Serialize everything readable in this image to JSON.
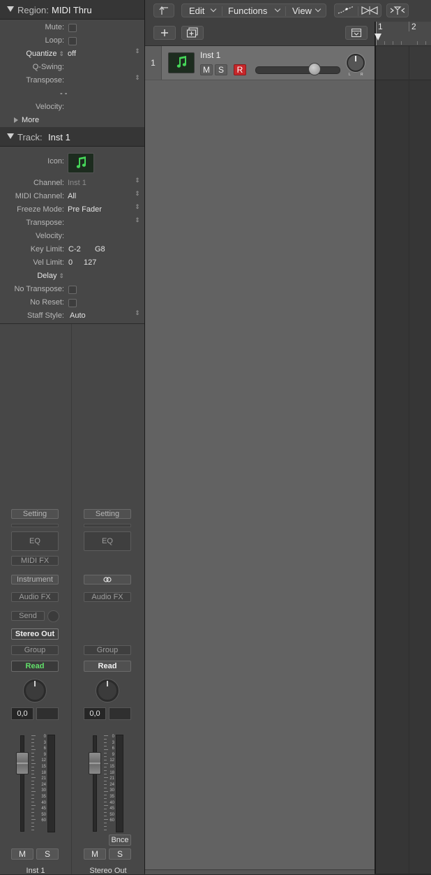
{
  "region": {
    "header_label": "Region:",
    "header_value": "MIDI Thru",
    "params": {
      "mute": "Mute:",
      "loop": "Loop:",
      "quantize_label": "Quantize",
      "quantize_value": "off",
      "qswing": "Q-Swing:",
      "transpose": "Transpose:",
      "dashes": "- -",
      "velocity": "Velocity:",
      "more": "More"
    }
  },
  "track": {
    "header_label": "Track:",
    "header_value": "Inst 1",
    "params": {
      "icon": "Icon:",
      "channel_label": "Channel:",
      "channel_value": "Inst 1",
      "midi_channel_label": "MIDI Channel:",
      "midi_channel_value": "All",
      "freeze_mode_label": "Freeze Mode:",
      "freeze_mode_value": "Pre Fader",
      "transpose": "Transpose:",
      "velocity": "Velocity:",
      "key_limit_label": "Key Limit:",
      "key_limit_low": "C-2",
      "key_limit_high": "G8",
      "vel_limit_label": "Vel Limit:",
      "vel_limit_low": "0",
      "vel_limit_high": "127",
      "delay": "Delay",
      "no_transpose": "No Transpose:",
      "no_reset": "No Reset:",
      "staff_style_label": "Staff Style:",
      "staff_style_value": "Auto"
    }
  },
  "strips": {
    "left": {
      "setting": "Setting",
      "eq": "EQ",
      "midi_fx": "MIDI FX",
      "instrument": "Instrument",
      "audio_fx": "Audio FX",
      "send": "Send",
      "output": "Stereo Out",
      "group": "Group",
      "automation": "Read",
      "volume": "0,0",
      "mute": "M",
      "solo": "S",
      "name": "Inst 1"
    },
    "right": {
      "setting": "Setting",
      "eq": "EQ",
      "audio_fx": "Audio FX",
      "group": "Group",
      "automation": "Read",
      "volume": "0,0",
      "bounce": "Bnce",
      "mute": "M",
      "solo": "S",
      "name": "Stereo Out"
    },
    "meter_scale": [
      "0",
      "3",
      "6",
      "9",
      "12",
      "15",
      "18",
      "21",
      "24",
      "30",
      "35",
      "40",
      "45",
      "50",
      "60"
    ]
  },
  "toolbar": {
    "edit": "Edit",
    "functions": "Functions",
    "view": "View"
  },
  "track_header": {
    "number": "1",
    "name": "Inst 1",
    "mute": "M",
    "solo": "S",
    "record": "R",
    "volume_fraction": 0.72,
    "pan_left": "L",
    "pan_right": "R"
  },
  "ruler": {
    "bars": [
      "1",
      "2"
    ]
  },
  "colors": {
    "accent_green": "#62e06a",
    "record_red": "#c7272a",
    "icon_green": "#45d658"
  }
}
